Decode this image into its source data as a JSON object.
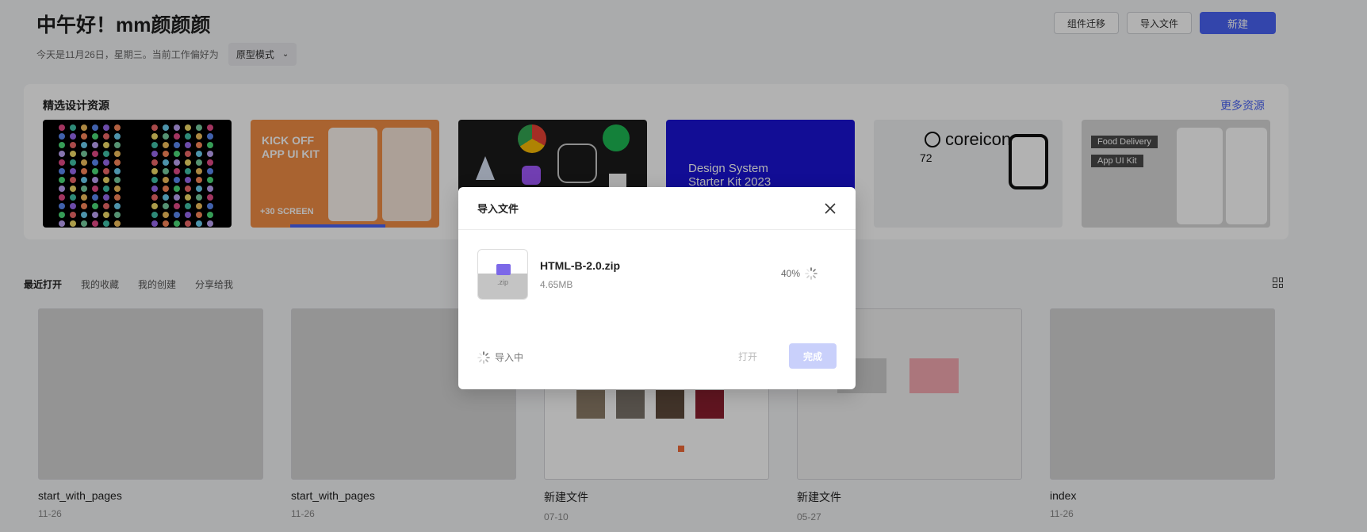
{
  "header": {
    "greeting": "中午好！mm颜颜颜",
    "subtitle": "今天是11月26日，星期三。当前工作偏好为",
    "mode": "原型模式",
    "actions": {
      "migrate": "组件迁移",
      "import": "导入文件",
      "new": "新建"
    }
  },
  "resources": {
    "title": "精选设计资源",
    "more": "更多资源",
    "cards": [
      {
        "text": ""
      },
      {
        "title": "KICK OFF\nAPP UI KIT",
        "tagline": "+30 SCREEN"
      },
      {
        "text": ""
      },
      {
        "title": "Design System\nStarter Kit 2023"
      },
      {
        "brand": "coreicon",
        "count": "72"
      },
      {
        "tags": [
          "Food Delivery",
          "App UI Kit"
        ]
      }
    ]
  },
  "tabs": [
    "最近打开",
    "我的收藏",
    "我的创建",
    "分享给我"
  ],
  "files": [
    {
      "name": "start_with_pages",
      "date": "11-26"
    },
    {
      "name": "start_with_pages",
      "date": "11-26"
    },
    {
      "name": "新建文件",
      "date": "07-10"
    },
    {
      "name": "新建文件",
      "date": "05-27"
    },
    {
      "name": "index",
      "date": "11-26"
    }
  ],
  "modal": {
    "title": "导入文件",
    "file": {
      "name": "HTML-B-2.0.zip",
      "size": "4.65MB",
      "ext": ".zip",
      "progress": "40%",
      "progress_value": 0.4
    },
    "status": "导入中",
    "open_label": "打开",
    "done_label": "完成"
  },
  "colors": {
    "primary": "#4a63f5",
    "primary_disabled": "#c9d0fb",
    "overlay": "rgba(0,0,0,0.30)"
  },
  "icons": {
    "close": "close-icon",
    "spinner": "spinner-icon",
    "grid": "grid-view-icon",
    "chevron": "chevron-down-icon"
  }
}
